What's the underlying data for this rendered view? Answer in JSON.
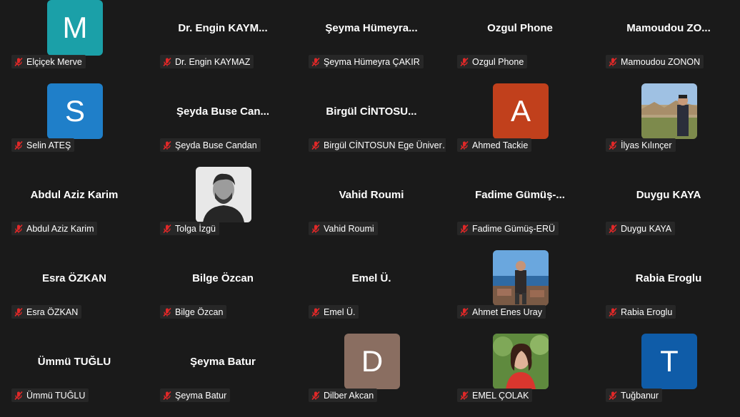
{
  "participants": [
    {
      "name": "Elçiçek Merve",
      "display": "",
      "initial": "M",
      "avatar_color": "#1ba0a8",
      "avatar_type": "initial"
    },
    {
      "name": "Dr. Engin KAYMAZ",
      "display": "Dr. Engin KAYM...",
      "avatar_type": "none"
    },
    {
      "name": "Şeyma Hümeyra ÇAKIR",
      "display": "Şeyma Hümeyra...",
      "avatar_type": "none"
    },
    {
      "name": "Ozgul Phone",
      "display": "Ozgul Phone",
      "avatar_type": "none"
    },
    {
      "name": "Mamoudou ZONON",
      "display": "Mamoudou ZO...",
      "avatar_type": "none"
    },
    {
      "name": "Selin ATEŞ",
      "display": "",
      "initial": "S",
      "avatar_color": "#1f7fc9",
      "avatar_type": "initial"
    },
    {
      "name": "Şeyda Buse Candan",
      "display": "Şeyda Buse Can...",
      "avatar_type": "none"
    },
    {
      "name": "Birgül CİNTOSUN Ege Üniversitesi",
      "display": "Birgül CİNTOSU...",
      "avatar_type": "none"
    },
    {
      "name": "Ahmed Tackie",
      "display": "",
      "initial": "A",
      "avatar_color": "#c1401c",
      "avatar_type": "initial"
    },
    {
      "name": "İlyas Kılınçer",
      "display": "",
      "avatar_type": "photo",
      "photo": "photo-landscape"
    },
    {
      "name": "Abdul Aziz Karim",
      "display": "Abdul Aziz Karim",
      "avatar_type": "none"
    },
    {
      "name": "Tolga İzgü",
      "display": "",
      "avatar_type": "photo",
      "photo": "photo-bw"
    },
    {
      "name": "Vahid Roumi",
      "display": "Vahid Roumi",
      "avatar_type": "none"
    },
    {
      "name": "Fadime Gümüş-ERÜ",
      "display": "Fadime Gümüş-...",
      "avatar_type": "none"
    },
    {
      "name": "Duygu KAYA",
      "display": "Duygu KAYA",
      "avatar_type": "none"
    },
    {
      "name": "Esra ÖZKAN",
      "display": "Esra ÖZKAN",
      "avatar_type": "none"
    },
    {
      "name": "Bilge Özcan",
      "display": "Bilge Özcan",
      "avatar_type": "none"
    },
    {
      "name": "Emel Ü.",
      "display": "Emel Ü.",
      "avatar_type": "none"
    },
    {
      "name": "Ahmet Enes Uray",
      "display": "",
      "avatar_type": "photo",
      "photo": "photo-sea"
    },
    {
      "name": "Rabia Eroglu",
      "display": "Rabia Eroglu",
      "avatar_type": "none"
    },
    {
      "name": "Ümmü TUĞLU",
      "display": "Ümmü TUĞLU",
      "avatar_type": "none"
    },
    {
      "name": "Şeyma Batur",
      "display": "Şeyma Batur",
      "avatar_type": "none"
    },
    {
      "name": "Dilber Akcan",
      "display": "",
      "initial": "D",
      "avatar_color": "#8a6e61",
      "avatar_type": "initial"
    },
    {
      "name": "EMEL ÇOLAK",
      "display": "",
      "avatar_type": "photo",
      "photo": "photo-green"
    },
    {
      "name": "Tuğbanur",
      "display": "",
      "initial": "T",
      "avatar_color": "#0f5ca8",
      "avatar_type": "initial"
    }
  ],
  "icons": {
    "muted": "mic-muted-icon"
  },
  "colors": {
    "background": "#1a1a1a",
    "muted_red": "#e02828"
  }
}
